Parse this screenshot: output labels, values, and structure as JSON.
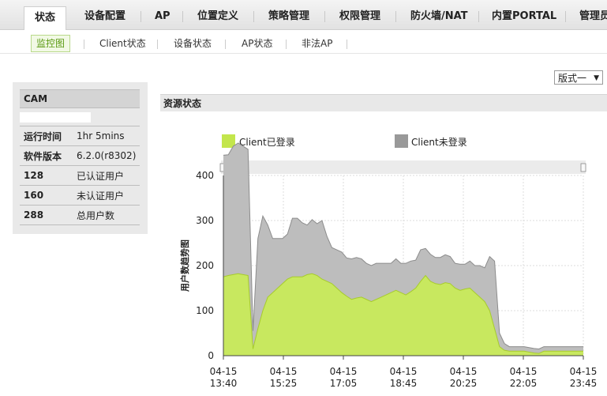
{
  "top_nav": [
    {
      "label": "状态",
      "active": true
    },
    {
      "label": "设备配置"
    },
    {
      "label": "AP"
    },
    {
      "label": "位置定义"
    },
    {
      "label": "策略管理"
    },
    {
      "label": "权限管理"
    },
    {
      "label": "防火墙/NAT"
    },
    {
      "label": "内置PORTAL"
    },
    {
      "label": "管理员"
    }
  ],
  "sub_nav": [
    {
      "label": "监控图",
      "active": true
    },
    {
      "label": "Client状态"
    },
    {
      "label": "设备状态"
    },
    {
      "label": "AP状态"
    },
    {
      "label": "非法AP"
    }
  ],
  "info": {
    "header": "CAM",
    "rows": [
      {
        "key": "运行时间",
        "value": "1hr 5mins"
      },
      {
        "key": "软件版本",
        "value": "6.2.0(r8302)"
      },
      {
        "key": "128",
        "value": "已认证用户"
      },
      {
        "key": "160",
        "value": "未认证用户"
      },
      {
        "key": "288",
        "value": "总用户数"
      }
    ]
  },
  "layout_select": {
    "value": "版式一"
  },
  "resource_title": "资源状态",
  "chart_data": {
    "type": "area",
    "legend": [
      {
        "name": "Client已登录",
        "color": "#c3e64c"
      },
      {
        "name": "Client未登录",
        "color": "#a9a9a9"
      }
    ],
    "ylabel": "用户数趋势图",
    "ylim": [
      0,
      400
    ],
    "yticks": [
      0,
      100,
      200,
      300,
      400
    ],
    "xticks": [
      {
        "date": "04-15",
        "time": "13:40"
      },
      {
        "date": "04-15",
        "time": "15:25"
      },
      {
        "date": "04-15",
        "time": "17:05"
      },
      {
        "date": "04-15",
        "time": "18:45"
      },
      {
        "date": "04-15",
        "time": "20:25"
      },
      {
        "date": "04-15",
        "time": "22:05"
      },
      {
        "date": "04-15",
        "time": "23:45"
      }
    ],
    "x_minutes": [
      0,
      5,
      10,
      15,
      20,
      25,
      30,
      35,
      40,
      45,
      50,
      55,
      60,
      65,
      70,
      75,
      80,
      85,
      90,
      95,
      100,
      105,
      110,
      115,
      120,
      125,
      130,
      135,
      140,
      145,
      150,
      155,
      160,
      165,
      170,
      175,
      180,
      185,
      190,
      195,
      200,
      205,
      210,
      215,
      220,
      225,
      230,
      235,
      240,
      245,
      250,
      255,
      260,
      265,
      270,
      275,
      280,
      285,
      290,
      295,
      300,
      305,
      310,
      315,
      320,
      325,
      330,
      335,
      340,
      345,
      350,
      355,
      360,
      365
    ],
    "series": [
      {
        "name": "Client已登录",
        "values": [
          175,
          178,
          180,
          182,
          180,
          178,
          15,
          60,
          100,
          130,
          140,
          150,
          160,
          170,
          175,
          175,
          175,
          180,
          182,
          178,
          170,
          165,
          160,
          150,
          140,
          132,
          125,
          128,
          130,
          125,
          120,
          125,
          130,
          135,
          140,
          145,
          140,
          135,
          142,
          150,
          165,
          178,
          165,
          160,
          158,
          162,
          160,
          150,
          145,
          148,
          150,
          140,
          130,
          120,
          100,
          60,
          20,
          12,
          10,
          10,
          10,
          10,
          8,
          6,
          5,
          10,
          10,
          10,
          10,
          10,
          10,
          10,
          10,
          10
        ]
      },
      {
        "name": "Client未登录",
        "values": [
          270,
          268,
          285,
          290,
          285,
          280,
          40,
          200,
          210,
          160,
          120,
          110,
          100,
          100,
          130,
          130,
          120,
          110,
          120,
          115,
          130,
          100,
          80,
          85,
          90,
          85,
          90,
          90,
          85,
          80,
          80,
          80,
          75,
          70,
          65,
          70,
          65,
          70,
          68,
          62,
          70,
          60,
          60,
          58,
          60,
          62,
          60,
          55,
          58,
          55,
          60,
          60,
          70,
          75,
          120,
          150,
          30,
          15,
          10,
          10,
          10,
          10,
          10,
          10,
          10,
          10,
          10,
          10,
          10,
          10,
          10,
          10,
          10,
          10
        ]
      }
    ]
  }
}
